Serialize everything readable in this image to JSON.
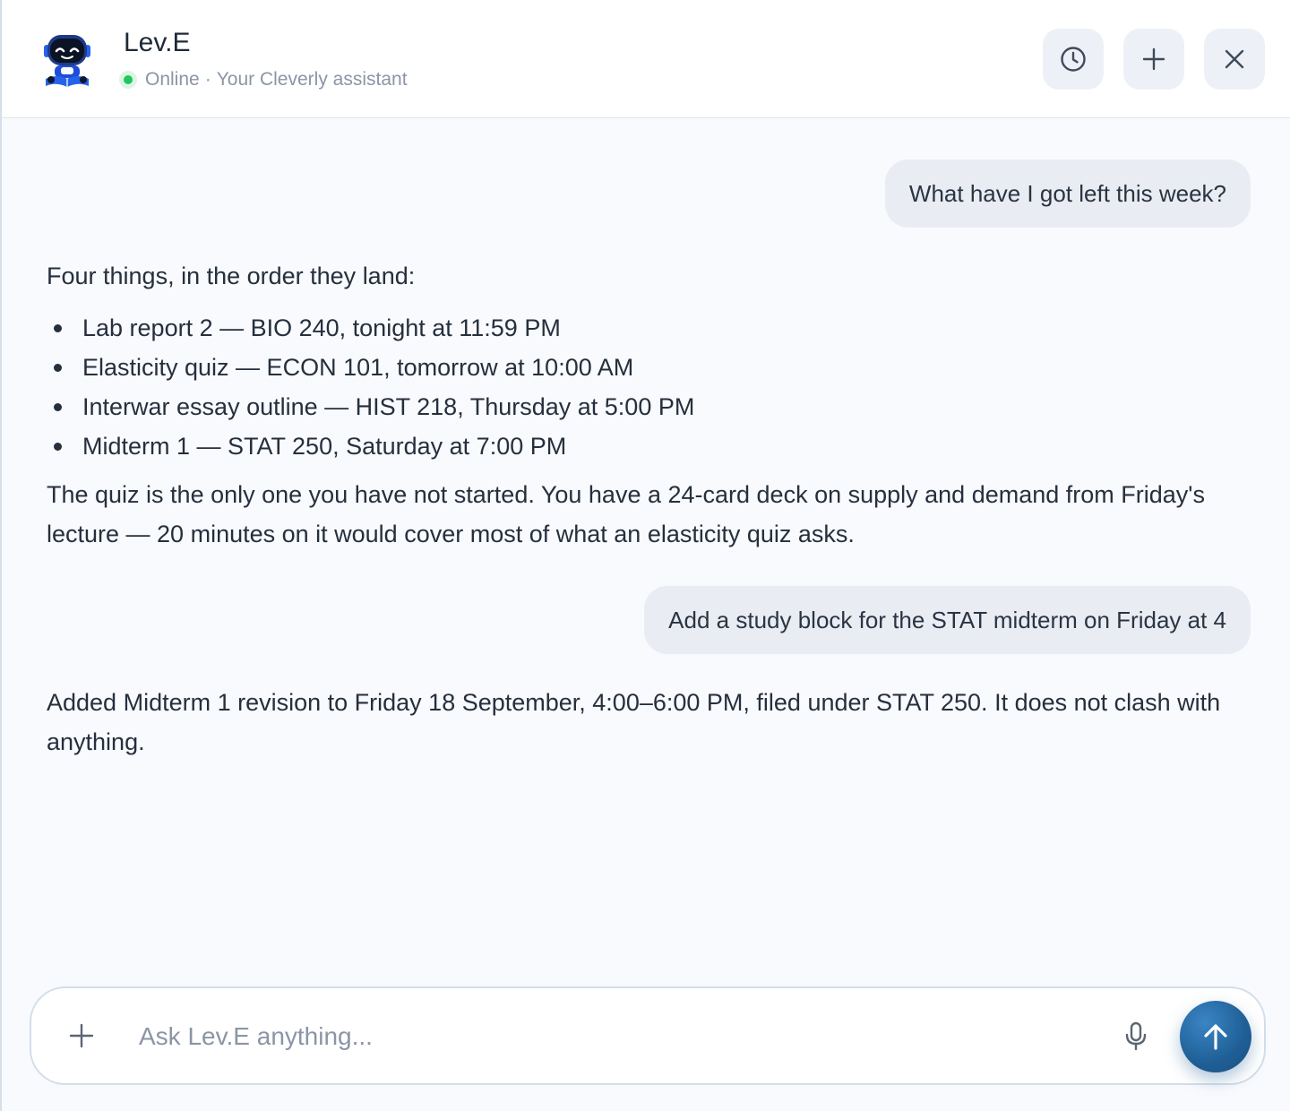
{
  "header": {
    "assistant_name": "Lev.E",
    "status": "Online",
    "separator": "·",
    "tagline": "Your Cleverly assistant",
    "status_color": "#22c55e",
    "buttons": {
      "history_icon": "clock-icon",
      "new_chat_icon": "plus-icon",
      "close_icon": "close-icon"
    }
  },
  "conversation": [
    {
      "role": "user",
      "text": "What have I got left this week?"
    },
    {
      "role": "assistant",
      "intro": "Four things, in the order they land:",
      "items": [
        "Lab report 2 — BIO 240, tonight at 11:59 PM",
        "Elasticity quiz — ECON 101, tomorrow at 10:00 AM",
        "Interwar essay outline — HIST 218, Thursday at 5:00 PM",
        "Midterm 1 — STAT 250, Saturday at 7:00 PM"
      ],
      "outro": "The quiz is the only one you have not started. You have a 24-card deck on supply and demand from Friday's lecture — 20 minutes on it would cover most of what an elasticity quiz asks."
    },
    {
      "role": "user",
      "text": "Add a study block for the STAT midterm on Friday at 4"
    },
    {
      "role": "assistant",
      "text": "Added Midterm 1 revision to Friday 18 September, 4:00–6:00 PM, filed under STAT 250. It does not clash with anything."
    }
  ],
  "composer": {
    "placeholder": "Ask Lev.E anything...",
    "value": "",
    "attach_icon": "plus-icon",
    "mic_icon": "microphone-icon",
    "send_icon": "arrow-up-icon",
    "send_color": "#1f5f96"
  }
}
